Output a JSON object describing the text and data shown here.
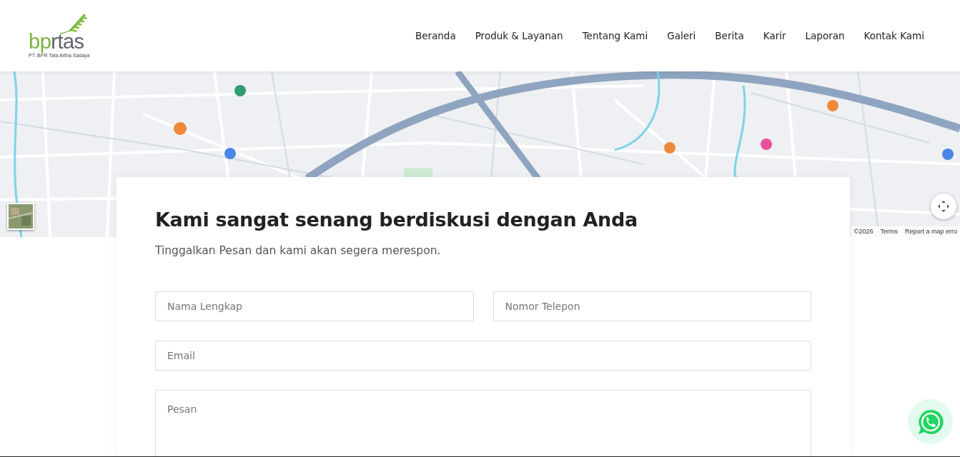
{
  "header": {
    "logo": {
      "primary": "bp",
      "secondary": "rtas",
      "tagline": "PT. BPR Tata Artha Sadaya"
    },
    "nav": [
      {
        "label": "Beranda"
      },
      {
        "label": "Produk & Layanan"
      },
      {
        "label": "Tentang Kami"
      },
      {
        "label": "Galeri"
      },
      {
        "label": "Berita"
      },
      {
        "label": "Karir"
      },
      {
        "label": "Laporan"
      },
      {
        "label": "Kontak Kami"
      }
    ]
  },
  "map": {
    "kind": "picture",
    "attribution": [
      "©2026",
      "Terms",
      "Report a map erro"
    ]
  },
  "contact_form": {
    "title": "Kami sangat senang berdiskusi dengan Anda",
    "subtitle": "Tinggalkan Pesan dan kami akan segera merespon.",
    "fields": [
      {
        "kind": "half",
        "placeholder": "Nama Lengkap"
      },
      {
        "kind": "half",
        "placeholder": "Nomor Telepon"
      },
      {
        "kind": "full",
        "placeholder": "Email"
      },
      {
        "kind": "textarea",
        "placeholder": "Pesan"
      }
    ]
  }
}
